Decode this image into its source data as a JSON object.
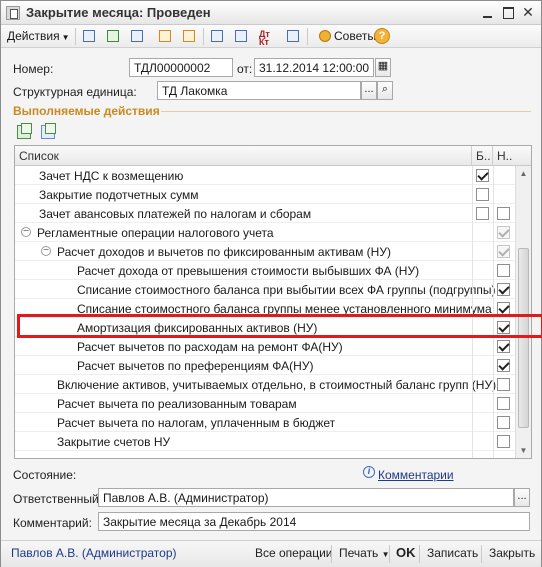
{
  "window": {
    "title": "Закрытие месяца: Проведен"
  },
  "toolbar": {
    "actions_label": "Действия",
    "dtkt_label": "Дт\nКт",
    "sovety_label": "Советы",
    "help_label": "?"
  },
  "form": {
    "number_label": "Номер:",
    "number_value": "ТДЛ00000002",
    "date_label": "от:",
    "date_value": "31.12.2014 12:00:00",
    "unit_label": "Структурная единица:",
    "unit_value": "ТД Лакомка",
    "unit_select_label": "...",
    "section_title": "Выполняемые действия"
  },
  "table": {
    "columns": [
      "Список",
      "Б..",
      "Н.."
    ],
    "rows": [
      {
        "label": "Зачет НДС к возмещению",
        "b": "checked",
        "n": "none"
      },
      {
        "label": "Закрытие подотчетных сумм",
        "b": "unchecked",
        "n": "none"
      },
      {
        "label": "Зачет авансовых платежей по налогам и сборам",
        "b": "unchecked",
        "n": "unchecked"
      },
      {
        "label": "Регламентные операции налогового учета",
        "toggle": "⊖",
        "b": "none",
        "n": "checked-dim"
      },
      {
        "label": "Расчет доходов и вычетов по фиксированным активам (НУ)",
        "toggle": "⊖",
        "b": "none",
        "n": "checked-dim"
      },
      {
        "label": "Расчет дохода от превышения стоимости выбывших ФА (НУ)",
        "b": "none",
        "n": "unchecked"
      },
      {
        "label": "Списание стоимостного баланса при выбытии всех ФА группы (подгруппы)",
        "b": "none",
        "n": "checked"
      },
      {
        "label": "Списание стоимостного баланса группы менее установленного минимума",
        "b": "none",
        "n": "checked"
      },
      {
        "label": "Амортизация фиксированных активов (НУ)",
        "b": "none",
        "n": "checked"
      },
      {
        "label": "Расчет вычетов по расходам на ремонт ФА(НУ)",
        "b": "none",
        "n": "checked"
      },
      {
        "label": "Расчет вычетов по преференциям ФА(НУ)",
        "b": "none",
        "n": "checked"
      },
      {
        "label": "Включение активов, учитываемых отдельно, в стоимостный баланс групп (НУ)",
        "b": "none",
        "n": "unchecked"
      },
      {
        "label": "Расчет вычета по реализованным товарам",
        "b": "none",
        "n": "unchecked"
      },
      {
        "label": "Расчет вычета по налогам, уплаченным в бюджет",
        "b": "none",
        "n": "unchecked"
      },
      {
        "label": "Закрытие счетов НУ",
        "b": "none",
        "n": "unchecked"
      }
    ]
  },
  "status": {
    "state_label": "Состояние:",
    "comments_link": "Комментарии",
    "comments_icon": "i",
    "responsible_label": "Ответственный:",
    "responsible_value": "Павлов А.В. (Администратор)",
    "responsible_select_label": "...",
    "comment_label": "Комментарий:",
    "comment_value": "Закрытие месяца за Декабрь 2014"
  },
  "footer": {
    "user_link": "Павлов А.В. (Администратор)",
    "all_ops": "Все операции",
    "print": "Печать",
    "ok": "OK",
    "save": "Записать",
    "close": "Закрыть"
  }
}
